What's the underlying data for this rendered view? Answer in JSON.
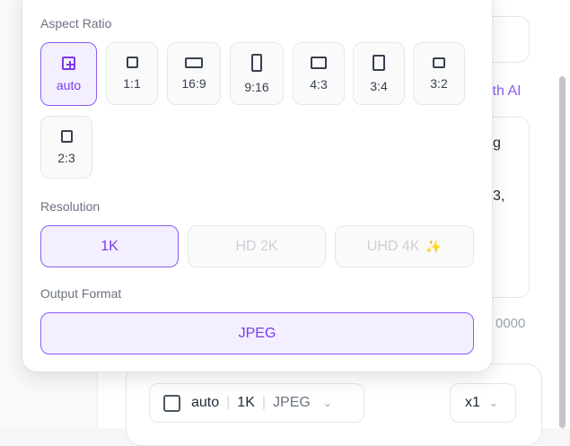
{
  "background": {
    "ai_link_fragment": "ith AI",
    "text_fragment_1": "g",
    "text_fragment_2": "3,",
    "counter_fragment": "0000",
    "settings_summary": {
      "ratio": "auto",
      "resolution": "1K",
      "format": "JPEG"
    },
    "image_count": "x1"
  },
  "popover": {
    "aspect_ratio_label": "Aspect Ratio",
    "aspect_ratios": [
      {
        "label": "auto",
        "selected": true
      },
      {
        "label": "1:1",
        "selected": false
      },
      {
        "label": "16:9",
        "selected": false
      },
      {
        "label": "9:16",
        "selected": false
      },
      {
        "label": "4:3",
        "selected": false
      },
      {
        "label": "3:4",
        "selected": false
      },
      {
        "label": "3:2",
        "selected": false
      },
      {
        "label": "2:3",
        "selected": false
      }
    ],
    "resolution_label": "Resolution",
    "resolutions": [
      {
        "label": "1K",
        "selected": true,
        "disabled": false
      },
      {
        "label": "HD 2K",
        "selected": false,
        "disabled": true
      },
      {
        "label": "UHD 4K",
        "selected": false,
        "disabled": true,
        "icon": "sparkles-icon"
      }
    ],
    "output_format_label": "Output Format",
    "output_formats": [
      {
        "label": "JPEG",
        "selected": true
      }
    ]
  },
  "colors": {
    "accent": "#7c3aed",
    "accent_border": "#8b5cf6",
    "accent_bg": "#f3efff",
    "sparkle": "#f59e0b"
  }
}
